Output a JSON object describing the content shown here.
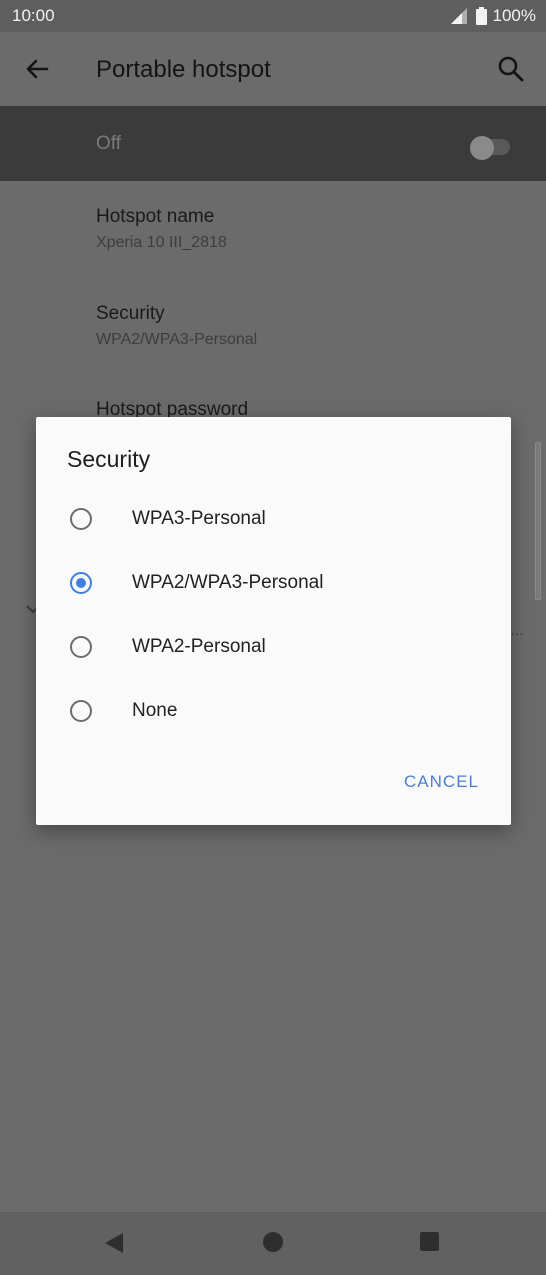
{
  "status_bar": {
    "time": "10:00",
    "battery": "100%"
  },
  "app_bar": {
    "title": "Portable hotspot"
  },
  "master_switch": {
    "label": "Off"
  },
  "settings": [
    {
      "title": "Hotspot name",
      "summary": "Xperia 10 III_2818"
    },
    {
      "title": "Security",
      "summary": "WPA2/WPA3-Personal"
    },
    {
      "title": "Hotspot password"
    }
  ],
  "dialog": {
    "title": "Security",
    "options": [
      {
        "label": "WPA3-Personal",
        "selected": false
      },
      {
        "label": "WPA2/WPA3-Personal",
        "selected": true
      },
      {
        "label": "WPA2-Personal",
        "selected": false
      },
      {
        "label": "None",
        "selected": false
      }
    ],
    "cancel_label": "CANCEL"
  },
  "colors": {
    "accent": "#3f7fe0",
    "scrim": "#6b6b6b",
    "dialog_bg": "#fafafa"
  },
  "icons": [
    "arrow-back-icon",
    "search-icon",
    "signal-icon",
    "battery-icon",
    "nav-back-icon",
    "nav-home-icon",
    "nav-recents-icon"
  ]
}
